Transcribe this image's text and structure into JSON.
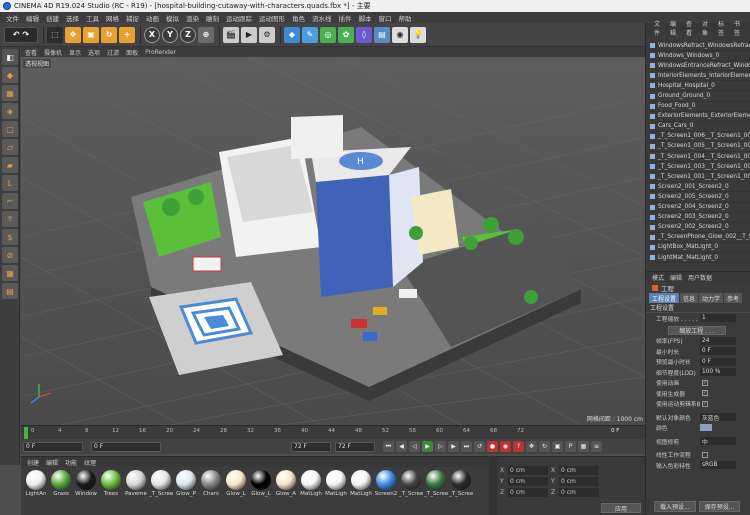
{
  "title_bar": {
    "text": "CINEMA 4D R19.024 Studio (RC - R19) - [hospital-building-cutaway-with-characters.quads.fbx *] - 主要"
  },
  "menu": [
    "文件",
    "编辑",
    "创建",
    "选择",
    "工具",
    "网格",
    "捕捉",
    "动画",
    "模拟",
    "渲染",
    "雕刻",
    "运动跟踪",
    "运动图形",
    "角色",
    "流水线",
    "插件",
    "脚本",
    "窗口",
    "帮助"
  ],
  "toolbar": {
    "axis_x": "X",
    "axis_y": "Y",
    "axis_z": "Z"
  },
  "viewport_menu": [
    "查看",
    "摄像机",
    "显示",
    "选项",
    "过滤",
    "面板",
    "ProRender"
  ],
  "viewport": {
    "label": "透视视图",
    "grid_scale": "网格间距 : 1000 cm"
  },
  "timeline": {
    "ticks": [
      "0",
      "4",
      "8",
      "12",
      "16",
      "20",
      "24",
      "28",
      "32",
      "36",
      "40",
      "44",
      "48",
      "52",
      "56",
      "60",
      "64",
      "68",
      "72"
    ],
    "end_label": "0 F"
  },
  "transport": {
    "start": "0 F",
    "current": "0 F",
    "end": "72 F",
    "end2": "72 F"
  },
  "material_panel": {
    "tabs": [
      "创建",
      "编辑",
      "功能",
      "纹理"
    ],
    "materials": [
      {
        "name": "LightAn",
        "color": "#f0f0f0"
      },
      {
        "name": "Grass",
        "color": "#5aa83a"
      },
      {
        "name": "Window",
        "color": "#1a1a1a"
      },
      {
        "name": "Trees",
        "color": "#6bbf3a"
      },
      {
        "name": "Paveme",
        "color": "#d6d6d6"
      },
      {
        "name": "_T_Scree",
        "color": "#e6e6e6"
      },
      {
        "name": "Glow_P",
        "color": "#dce8f0"
      },
      {
        "name": "Chars",
        "color": "#888888"
      },
      {
        "name": "Glow_L",
        "color": "#f8e8c8"
      },
      {
        "name": "Glow_L",
        "color": "#000000"
      },
      {
        "name": "Glow_A",
        "color": "#f3e6c9"
      },
      {
        "name": "MatLigh",
        "color": "#f6f6f6"
      },
      {
        "name": "MatLigh",
        "color": "#f5f5f5"
      },
      {
        "name": "MatLigh",
        "color": "#f4f4f4"
      },
      {
        "name": "Screen2",
        "color": "#3a8ee6"
      },
      {
        "name": "_T_Scree",
        "color": "#444444"
      },
      {
        "name": "_T_Scree",
        "color": "#3b7a44"
      },
      {
        "name": "_T_Scree",
        "color": "#2b2b2b"
      }
    ]
  },
  "coordinates": {
    "rows": [
      {
        "a": "X",
        "av": "0 cm",
        "b": "X",
        "bv": "0 cm"
      },
      {
        "a": "Y",
        "av": "0 cm",
        "b": "Y",
        "bv": "0 cm"
      },
      {
        "a": "Z",
        "av": "0 cm",
        "b": "Z",
        "bv": "0 cm"
      }
    ],
    "apply_label": "应用"
  },
  "object_manager": {
    "menu": [
      "文件",
      "编辑",
      "查看",
      "对象",
      "标签",
      "书签"
    ],
    "items": [
      "WindowsRefract_WindowsRefract",
      "Windows_Windows_0",
      "WindowsEntranceRefract_WindowsEntrance",
      "InteriorElements_InteriorElements_0",
      "Hospital_Hospital_0",
      "Ground_Ground_0",
      "Food_Food_0",
      "ExteriorElements_ExteriorElements_0",
      "Cars_Cars_0",
      "_T_Screen1_006__T_Screen1_006",
      "_T_Screen1_005__T_Screen1_005",
      "_T_Screen1_004__T_Screen1_004",
      "_T_Screen1_003__T_Screen1_003",
      "_T_Screen1_001__T_Screen1_001",
      "Screen2_001_Screen2_0",
      "Screen2_005_Screen2_0",
      "Screen2_004_Screen2_0",
      "Screen2_003_Screen2_0",
      "Screen2_002_Screen2_0",
      "_T_ScreenPhone_Glow_002__T_Scr",
      "LightBox_MatLight_0",
      "LightMat_MatLight_0"
    ]
  },
  "attributes": {
    "menu": [
      "模式",
      "编辑",
      "用户数据"
    ],
    "title": "工程",
    "tabs": [
      "工程设置",
      "信息",
      "动力学",
      "参考"
    ],
    "section": "工程设置",
    "rows": [
      {
        "label": "工程缩放 . . . . .",
        "value": "1"
      },
      {
        "label": "帧率(FPS)",
        "value": "24"
      },
      {
        "label": "最小时长",
        "value": "0 F"
      },
      {
        "label": "预览最小时长",
        "value": "0 F"
      },
      {
        "label": "细节程度(LOD)",
        "value": "100 %"
      }
    ],
    "scale_button": "缩放工程 . . .",
    "checks": [
      {
        "label": "使用动画",
        "checked": "✓"
      },
      {
        "label": "使用生成器",
        "checked": "✓"
      },
      {
        "label": "使用运动剪辑系统",
        "checked": "✓"
      }
    ],
    "default_obj_color_label": "默认对象颜色",
    "default_obj_color_value": "灰蓝色",
    "color_label": "颜色",
    "view_clip_label": "视图修剪",
    "view_clip_value": "中",
    "linear_label": "线性工作流程",
    "input_color_label": "输入色彩特性",
    "input_color_value": "sRGB",
    "bottom_buttons": [
      "载入预设...",
      "保存预设..."
    ]
  }
}
